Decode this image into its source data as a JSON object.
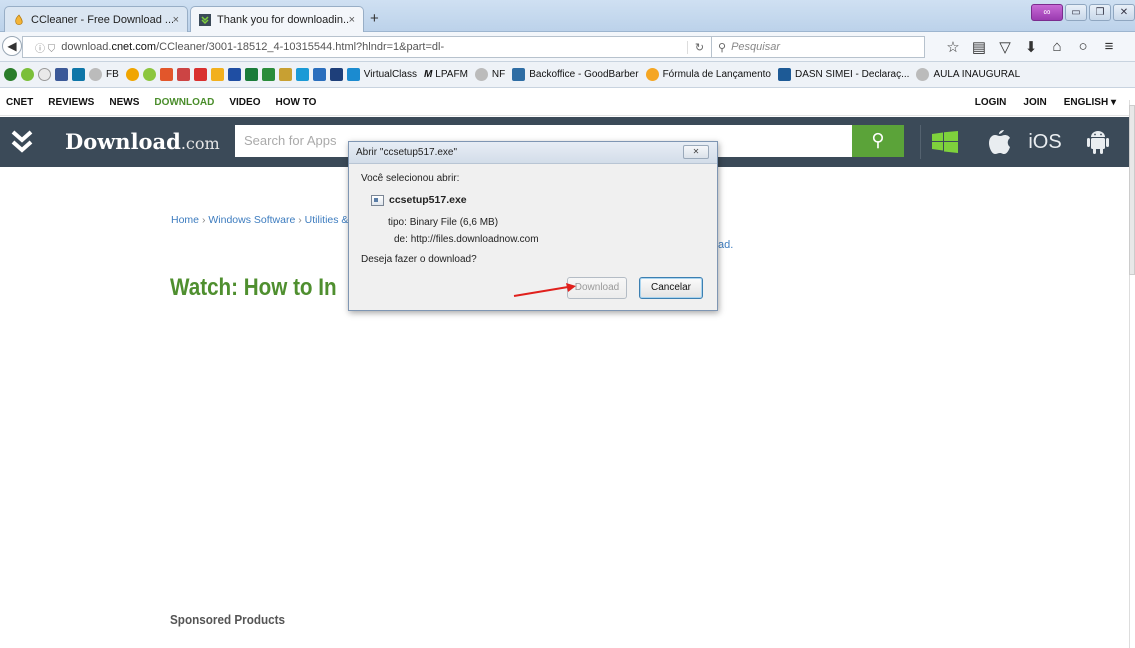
{
  "browser": {
    "tabs": [
      {
        "title": "CCleaner - Free Download ...",
        "close": "×"
      },
      {
        "title": "Thank you for downloadin...",
        "close": "×"
      }
    ],
    "new_tab": "+",
    "url": {
      "prefix": "download.",
      "host": "cnet.com",
      "path": "/CCleaner/3001-18512_4-10315544.html?hlndr=1&part=dl-"
    },
    "search_placeholder": "Pesquisar",
    "bookmarks": [
      "FB",
      "VirtualClass",
      "LPAFM",
      "NF",
      "Backoffice - GoodBarber",
      "Fórmula de Lançamento",
      "DASN SIMEI - Declaraç...",
      "AULA INAUGURAL"
    ]
  },
  "site": {
    "nav_left": [
      "CNET",
      "REVIEWS",
      "NEWS",
      "DOWNLOAD",
      "VIDEO",
      "HOW TO"
    ],
    "nav_right": [
      "LOGIN",
      "JOIN",
      "ENGLISH ▾"
    ],
    "logo_main": "Download",
    "logo_domain": ".com",
    "search_placeholder": "Search for Apps",
    "platforms": {
      "ios": "iOS"
    }
  },
  "page": {
    "breadcrumb": [
      "Home",
      "Windows Software",
      "Utilities &"
    ],
    "after_text": "ad.",
    "heading": "Watch: How to In",
    "sponsored": "Sponsored Products"
  },
  "dialog": {
    "title": "Abrir \"ccsetup517.exe\"",
    "intro": "Você selecionou abrir:",
    "filename": "ccsetup517.exe",
    "type_label": "tipo:",
    "type_value": "Binary File (6,6 MB)",
    "from_label": "de:",
    "from_value": "http://files.downloadnow.com",
    "question": "Deseja fazer o download?",
    "download_button": "Download",
    "cancel_button": "Cancelar",
    "close_button": "✕"
  },
  "colors": {
    "accent_green": "#5ba339",
    "header_bg": "#3b4a58",
    "annotation_arrow": "#e0201c"
  }
}
